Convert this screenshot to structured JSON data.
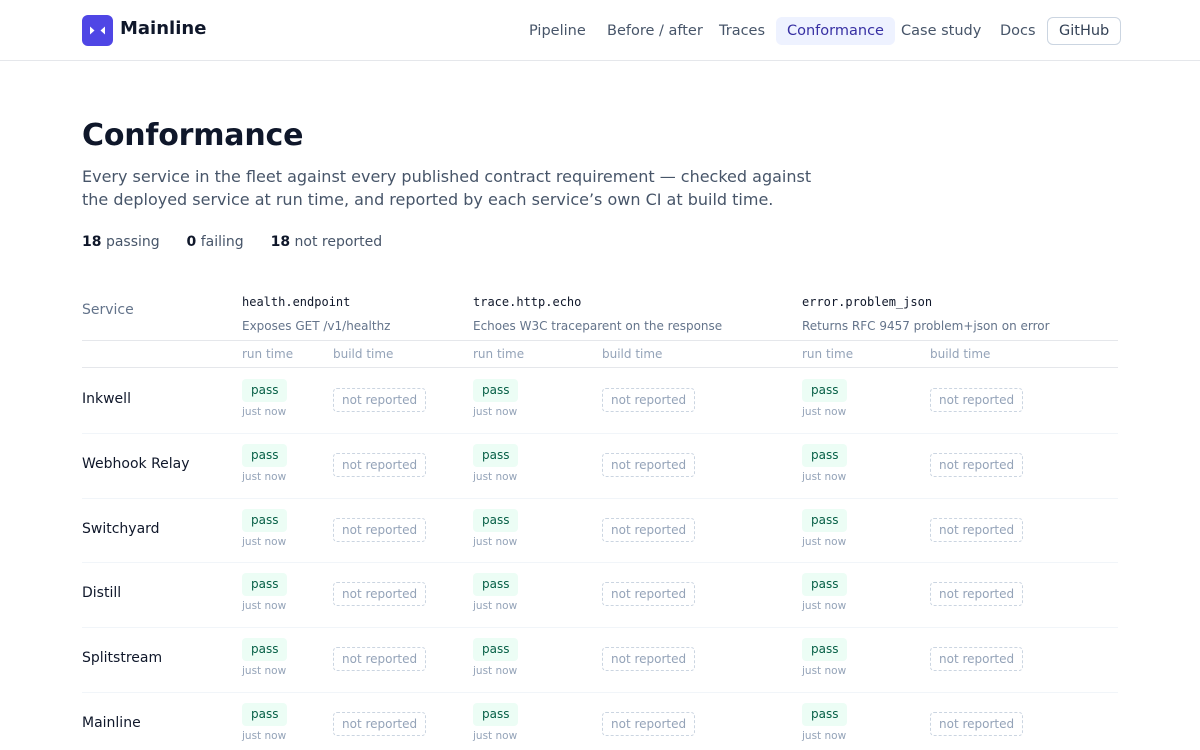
{
  "header": {
    "brand": "Mainline",
    "nav": [
      {
        "label": "Pipeline"
      },
      {
        "label": "Before / after"
      },
      {
        "label": "Traces"
      },
      {
        "label": "Conformance"
      },
      {
        "label": "Case study"
      },
      {
        "label": "Docs"
      },
      {
        "label": "GitHub"
      }
    ],
    "active_nav": "Conformance"
  },
  "page": {
    "title": "Conformance",
    "lede": "Every service in the fleet against every published contract requirement — checked against the deployed service at run time, and reported by each service’s own CI at build time.",
    "summary": {
      "passing_count": "18",
      "passing_label": "passing",
      "failing_count": "0",
      "failing_label": "failing",
      "not_reported_count": "18",
      "not_reported_label": "not reported"
    }
  },
  "table": {
    "service_header": "Service",
    "run_label": "run time",
    "build_label": "build time",
    "requirements": [
      {
        "id": "health.endpoint",
        "description": "Exposes GET /v1/healthz"
      },
      {
        "id": "trace.http.echo",
        "description": "Echoes W3C traceparent on the response"
      },
      {
        "id": "error.problem_json",
        "description": "Returns RFC 9457 problem+json on error"
      }
    ],
    "rows": [
      {
        "service": "Inkwell",
        "cells": [
          {
            "run": "pass",
            "when": "just now",
            "build": "not reported"
          },
          {
            "run": "pass",
            "when": "just now",
            "build": "not reported"
          },
          {
            "run": "pass",
            "when": "just now",
            "build": "not reported"
          }
        ]
      },
      {
        "service": "Webhook Relay",
        "cells": [
          {
            "run": "pass",
            "when": "just now",
            "build": "not reported"
          },
          {
            "run": "pass",
            "when": "just now",
            "build": "not reported"
          },
          {
            "run": "pass",
            "when": "just now",
            "build": "not reported"
          }
        ]
      },
      {
        "service": "Switchyard",
        "cells": [
          {
            "run": "pass",
            "when": "just now",
            "build": "not reported"
          },
          {
            "run": "pass",
            "when": "just now",
            "build": "not reported"
          },
          {
            "run": "pass",
            "when": "just now",
            "build": "not reported"
          }
        ]
      },
      {
        "service": "Distill",
        "cells": [
          {
            "run": "pass",
            "when": "just now",
            "build": "not reported"
          },
          {
            "run": "pass",
            "when": "just now",
            "build": "not reported"
          },
          {
            "run": "pass",
            "when": "just now",
            "build": "not reported"
          }
        ]
      },
      {
        "service": "Splitstream",
        "cells": [
          {
            "run": "pass",
            "when": "just now",
            "build": "not reported"
          },
          {
            "run": "pass",
            "when": "just now",
            "build": "not reported"
          },
          {
            "run": "pass",
            "when": "just now",
            "build": "not reported"
          }
        ]
      },
      {
        "service": "Mainline",
        "cells": [
          {
            "run": "pass",
            "when": "just now",
            "build": "not reported"
          },
          {
            "run": "pass",
            "when": "just now",
            "build": "not reported"
          },
          {
            "run": "pass",
            "when": "just now",
            "build": "not reported"
          }
        ]
      }
    ]
  },
  "colors": {
    "accent": "#4f46e5",
    "pass_bg": "#ecfdf5",
    "pass_text": "#065f46",
    "muted": "#94a3b8"
  },
  "icons": {
    "logo": "collapse-arrows-icon"
  }
}
